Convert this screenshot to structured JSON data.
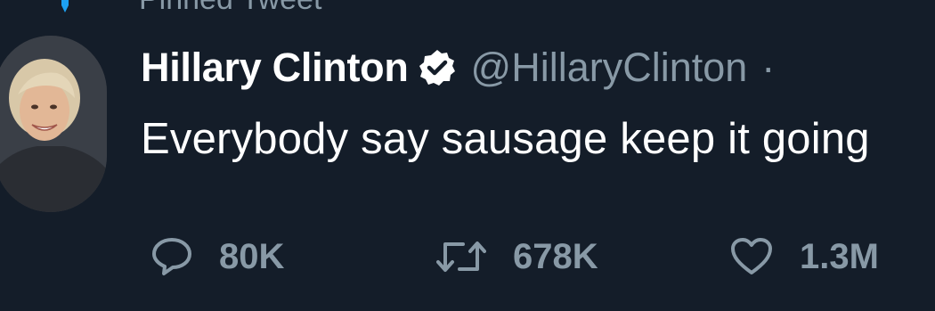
{
  "pinned": {
    "label": "Pinned Tweet",
    "icon": "pin-icon"
  },
  "author": {
    "display_name": "Hillary Clinton",
    "handle": "@HillaryClinton",
    "separator": "·",
    "verified_icon": "verified-badge-icon",
    "avatar": "profile-avatar"
  },
  "tweet": {
    "text": "Everybody say sausage keep it going"
  },
  "actions": {
    "reply": {
      "icon": "reply-icon",
      "count": "80K"
    },
    "retweet": {
      "icon": "retweet-icon",
      "count": "678K"
    },
    "like": {
      "icon": "heart-icon",
      "count": "1.3M"
    }
  },
  "colors": {
    "background": "#141d29",
    "primary_text": "#ffffff",
    "secondary_text": "#8899a6",
    "pin_accent": "#1da1f2"
  }
}
